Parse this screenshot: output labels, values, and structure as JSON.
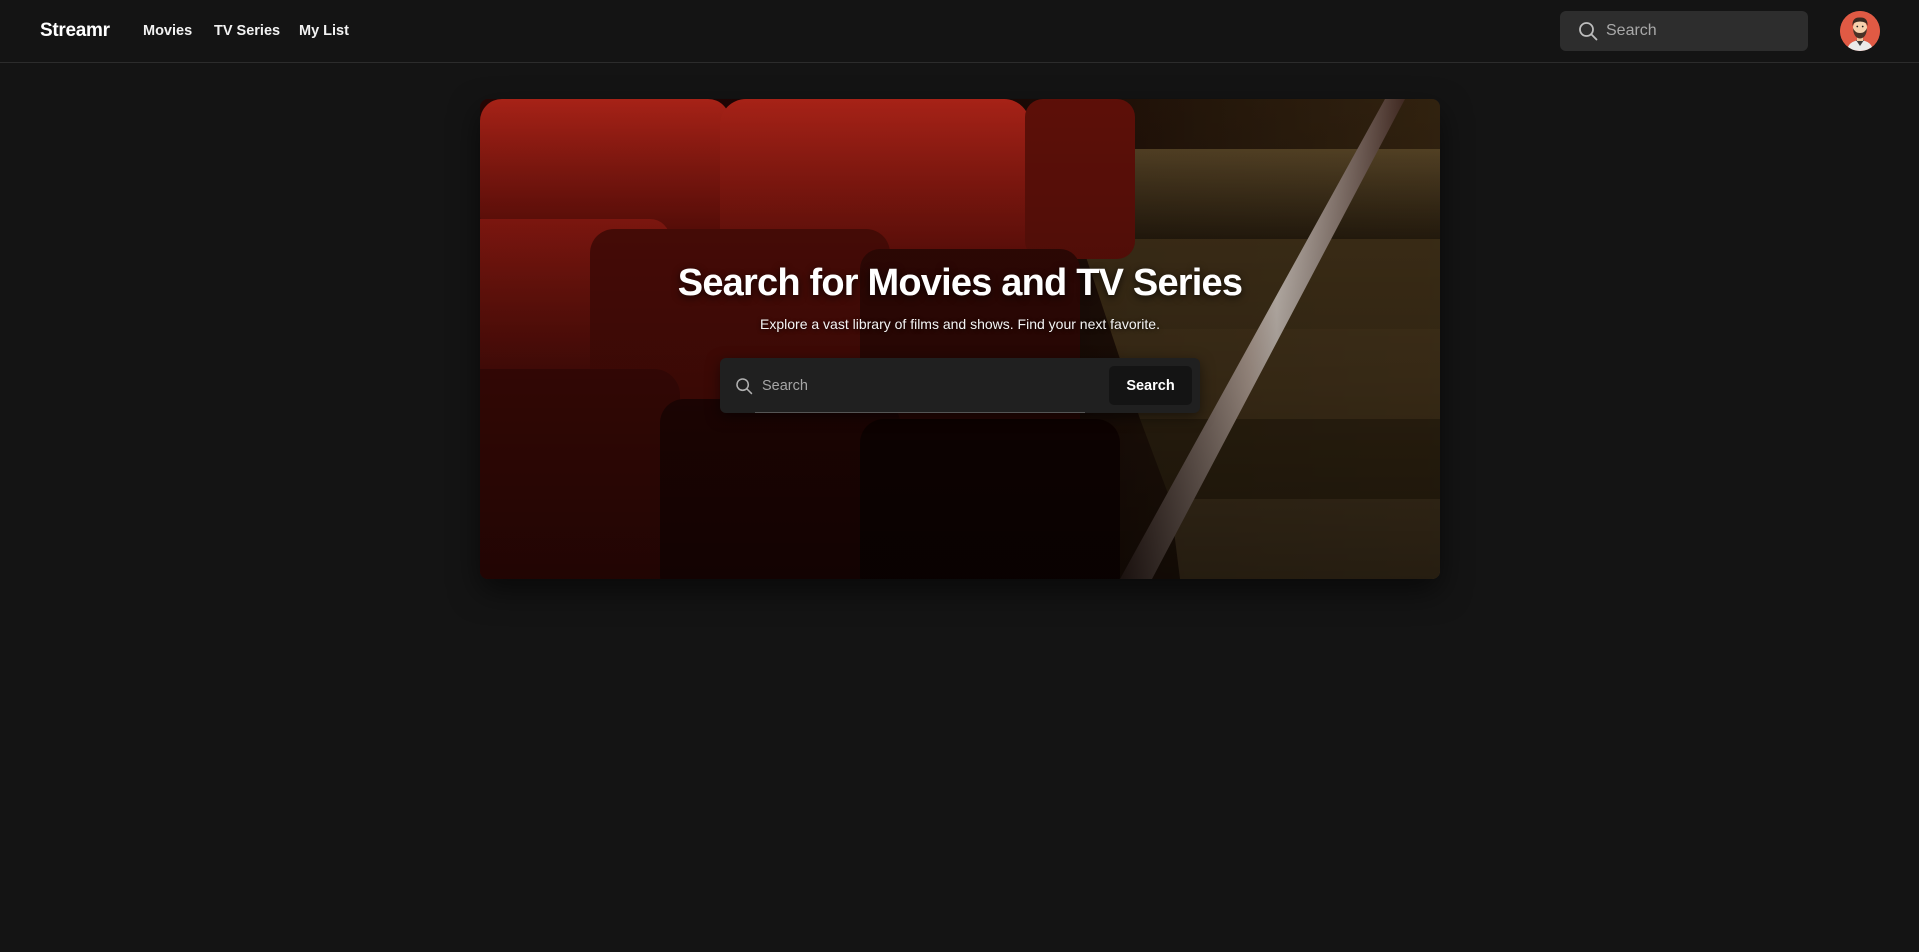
{
  "app": {
    "logo": "Streamr"
  },
  "nav": {
    "items": [
      {
        "label": "Movies"
      },
      {
        "label": "TV Series"
      },
      {
        "label": "My List"
      }
    ]
  },
  "top_search": {
    "placeholder": "Search",
    "icon": "search-icon"
  },
  "user": {
    "avatar_icon": "user-avatar-bearded-man"
  },
  "hero": {
    "title": "Search for Movies and TV Series",
    "subtitle": "Explore a vast library of films and shows. Find your next favorite.",
    "search": {
      "placeholder": "Search",
      "icon": "search-icon",
      "button_label": "Search"
    }
  },
  "colors": {
    "background": "#141414",
    "header_search_bg": "#2d2d2d",
    "avatar_bg": "#e05a44",
    "seat_red": "#b3231a"
  }
}
